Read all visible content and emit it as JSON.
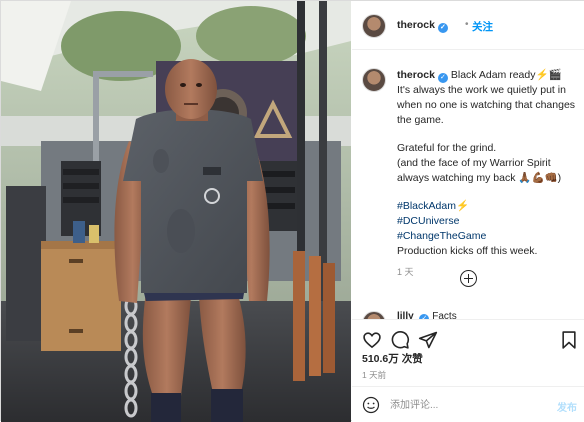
{
  "header": {
    "username": "therock",
    "verified_mark": "✓",
    "separator": "•",
    "follow_label": "关注"
  },
  "caption": {
    "username": "therock",
    "lines": [
      "Black Adam ready⚡🎬",
      "It's always the work we quietly put in",
      "when no one is watching that changes",
      "the game.",
      "Grateful for the grind.",
      "(and the face of my Warrior Spirit",
      "always watching my back 🙏🏾💪🏾👊🏾)"
    ],
    "hashtags": [
      "#BlackAdam⚡",
      "#DCUniverse",
      "#ChangeTheGame"
    ],
    "closing": "Production kicks off this week.",
    "time": "1 天"
  },
  "next_comment": {
    "username": "lilly",
    "text": "Facts"
  },
  "actions": {
    "icons": [
      "heart-icon",
      "comment-icon",
      "share-icon",
      "bookmark-icon"
    ],
    "likes": "510.6万 次赞",
    "time_ago": "1 天前"
  },
  "composer": {
    "placeholder": "添加评论...",
    "post_label": "发布"
  },
  "colors": {
    "link": "#00376b",
    "follow": "#0095f6",
    "post_disabled": "#b2dffc",
    "verified": "#3897f0"
  }
}
